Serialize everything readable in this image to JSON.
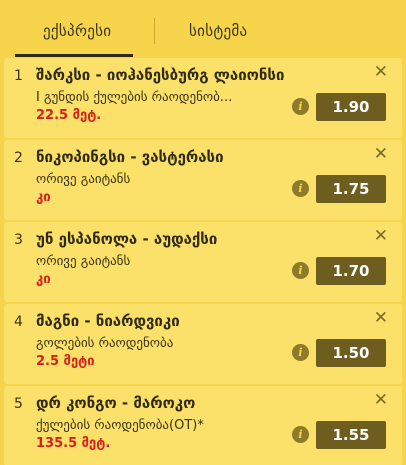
{
  "tabs": {
    "express": "ექსპრესი",
    "system": "სისტემა"
  },
  "items": [
    {
      "num": "1",
      "teams": "შარკსი - იოჰანესბურგ ლაიონსი",
      "market": "I გუნდის ქულების რაოდენობ...",
      "selection": "22.5 მეტ.",
      "odds": "1.90"
    },
    {
      "num": "2",
      "teams": "ნიკოპინგსი - ვასტერასი",
      "market": "ორივე გაიტანს",
      "selection": "კი",
      "odds": "1.75"
    },
    {
      "num": "3",
      "teams": "უნ ესპანოლა - აუდაქსი",
      "market": "ორივე გაიტანს",
      "selection": "კი",
      "odds": "1.70"
    },
    {
      "num": "4",
      "teams": "მაგნი - ნიარდვიკი",
      "market": "გოლების რაოდენობა",
      "selection": "2.5 მეტი",
      "odds": "1.50"
    },
    {
      "num": "5",
      "teams": "დრ კონგო - მაროკო",
      "market": "ქულების რაოდენობა(OT)*",
      "selection": "135.5 მეტ.",
      "odds": "1.55"
    }
  ],
  "icons": {
    "close": "close-icon",
    "info": "info-icon"
  },
  "colors": {
    "background": "#f6d54c",
    "card": "#fbe06a",
    "odds_button": "#6d5d1e",
    "selection_text": "#d4211b"
  }
}
